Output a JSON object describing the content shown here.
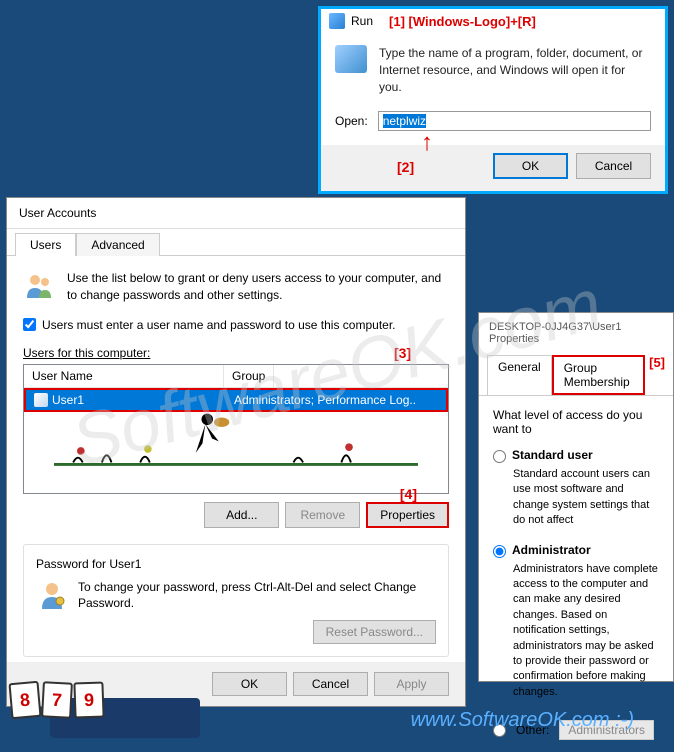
{
  "run": {
    "title": "Run",
    "annotation1": "[1] [Windows-Logo]+[R]",
    "instruction": "Type the name of a program, folder, document, or Internet resource, and Windows will open it for you.",
    "open_label": "Open:",
    "input_value": "netplwiz",
    "annotation2": "[2]",
    "ok": "OK",
    "cancel": "Cancel"
  },
  "ua": {
    "title": "User Accounts",
    "tab_users": "Users",
    "tab_advanced": "Advanced",
    "intro": "Use the list below to grant or deny users access to your computer, and to change passwords and other settings.",
    "checkbox_label": "Users must enter a user name and password to use this computer.",
    "list_label": "Users for this computer:",
    "col_username": "User Name",
    "col_group": "Group",
    "annotation3": "[3]",
    "row_user": "User1",
    "row_group": "Administrators; Performance Log..",
    "btn_add": "Add...",
    "btn_remove": "Remove",
    "btn_properties": "Properties",
    "annotation4": "[4]",
    "password_section": "Password for User1",
    "password_text": "To change your password, press Ctrl-Alt-Del and select Change Password.",
    "btn_reset": "Reset Password...",
    "btn_ok": "OK",
    "btn_cancel": "Cancel",
    "btn_apply": "Apply"
  },
  "props": {
    "title": "DESKTOP-0JJ4G37\\User1 Properties",
    "tab_general": "General",
    "tab_group": "Group Membership",
    "annotation5": "[5]",
    "question": "What level of access do you want to",
    "opt_standard": "Standard user",
    "desc_standard": "Standard account users can use most software and change system settings that do not affect",
    "opt_admin": "Administrator",
    "desc_admin": "Administrators have complete access to the computer and can make any desired changes. Based on notification settings, administrators may be asked to provide their password or confirmation before making changes.",
    "opt_other": "Other:",
    "other_value": "Administrators"
  },
  "footer": {
    "c1": "8",
    "c2": "7",
    "c3": "9",
    "url": "www.SoftwareOK.com :-)"
  },
  "watermark": "SoftwareOK.com"
}
